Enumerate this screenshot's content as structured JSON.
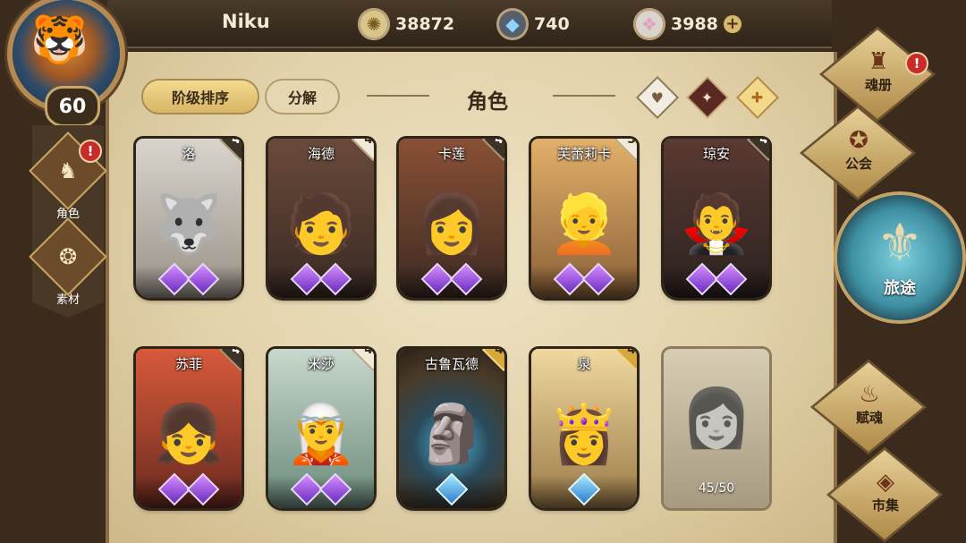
{
  "player": {
    "name": "Niku",
    "level": "60"
  },
  "currencies": [
    {
      "icon": "gold-coin-icon",
      "value": "38872"
    },
    {
      "icon": "blue-crystal-icon",
      "value": "740"
    },
    {
      "icon": "gem-icon",
      "value": "3988",
      "addable": true
    }
  ],
  "left_tabs": [
    {
      "label": "角色",
      "icon": "helmet-icon",
      "alert": "!"
    },
    {
      "label": "素材",
      "icon": "material-icon"
    }
  ],
  "toolbar": {
    "sort_label": "阶级排序",
    "decompose_label": "分解",
    "title": "角色"
  },
  "filters": [
    "heart-icon",
    "sword-icon",
    "badge-icon"
  ],
  "characters": [
    {
      "name": "洛",
      "level": "45",
      "badge": "dark",
      "gem": "purple"
    },
    {
      "name": "海德",
      "level": "46",
      "badge": "white",
      "gem": "purple"
    },
    {
      "name": "卡莲",
      "level": "45",
      "badge": "dark",
      "gem": "purple"
    },
    {
      "name": "芙蕾莉卡",
      "level": "50",
      "badge": "white",
      "gem": "purple"
    },
    {
      "name": "琼安",
      "level": "45",
      "badge": "dark",
      "gem": "purple"
    },
    {
      "name": "苏菲",
      "level": "45",
      "badge": "dark",
      "gem": "purple"
    },
    {
      "name": "米莎",
      "level": "45",
      "badge": "white",
      "gem": "purple"
    },
    {
      "name": "古鲁瓦德",
      "level": "45",
      "badge": "gold",
      "gem": "blue"
    },
    {
      "name": "泉",
      "level": "45",
      "badge": "gold",
      "gem": "blue"
    }
  ],
  "capacity": "45/50",
  "right_nav": [
    {
      "label": "魂册",
      "alert": "!"
    },
    {
      "label": "公会"
    },
    {
      "label": "旅途"
    },
    {
      "label": "赋魂"
    },
    {
      "label": "市集"
    }
  ]
}
